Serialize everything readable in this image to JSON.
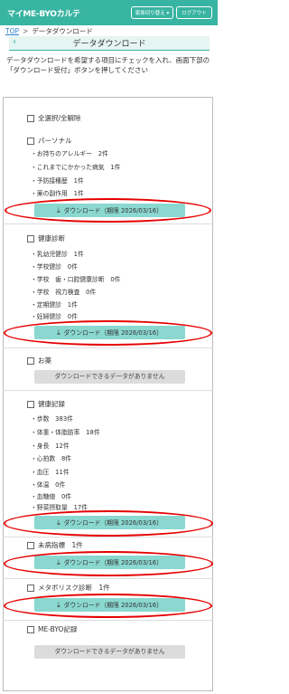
{
  "header": {
    "logo": "マイME-BYOカルテ",
    "family_switch": "家族切り替え ▾",
    "logout": "ログアウト"
  },
  "breadcrumb": {
    "top": "TOP",
    "separator": ">",
    "current": "データダウンロード"
  },
  "page": {
    "back_icon": "‹",
    "title": "データダウンロード",
    "intro": "データダウンロードを希望する項目にチェックを入れ、画面下部の「ダウンロード受付」ボタンを押してください"
  },
  "select_all": "全選択/全解除",
  "download_label": "ダウンロード（期限 2026/03/16）",
  "no_data_label": "ダウンロードできるデータがありません",
  "sections": {
    "personal": {
      "title": "パーソナル",
      "items": [
        "・お持ちのアレルギー　2件",
        "・これまでにかかった病気　1件",
        "・予防接種歴　1件",
        "・薬の副作用　1件"
      ]
    },
    "checkup": {
      "title": "健康診断",
      "items": [
        "・乳幼児健診　1件",
        "・学校健診　0件",
        "・学校　歯・口腔健康診断　0件",
        "・学校　視力検査　0件",
        "・定期健診　1件",
        "・妊婦健診　0件"
      ]
    },
    "medicine": {
      "title": "お薬"
    },
    "health": {
      "title": "健康記録",
      "items": [
        "・歩数　383件",
        "・体重・体脂肪率　18件",
        "・身長　12件",
        "・心拍数　8件",
        "・血圧　11件",
        "・体温　0件",
        "・血糖値　0件",
        "・野菜摂取量　17件"
      ]
    },
    "mibyo": {
      "title": "未病指標　1件"
    },
    "metabo": {
      "title": "メタボリスク診断　1件"
    },
    "mebyo_record": {
      "title": "ME-BYO記録"
    }
  },
  "icons": {
    "download": "download-icon",
    "back": "chevron-left-icon"
  },
  "colors": {
    "brand": "#38b4a2",
    "download_button": "#8ad8d0",
    "highlight": "#e60000"
  }
}
